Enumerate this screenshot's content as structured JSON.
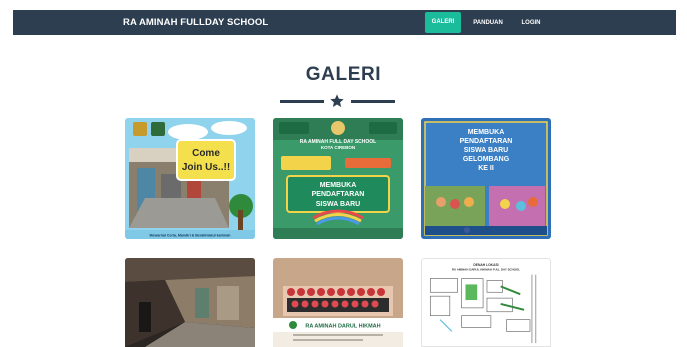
{
  "navbar": {
    "brand": "RA AMINAH FULLDAY SCHOOL",
    "items": [
      {
        "label": "GALERI",
        "active": true
      },
      {
        "label": "PANDUAN",
        "active": false
      },
      {
        "label": "LOGIN",
        "active": false
      }
    ],
    "background_color": "#2c3e50",
    "active_color": "#1abc9c"
  },
  "page": {
    "title": "GALERI",
    "divider_icon": "star-icon"
  },
  "gallery": {
    "items": [
      {
        "poster_line1": "Come",
        "poster_line2": "Join Us..!!",
        "caption": "Mewarnai Ceria, Mandiri & Berakhlakul karimah"
      },
      {
        "school_line1": "RA AMINAH FULL DAY SCHOOL",
        "school_line2": "KOTA CIREBON",
        "banner_line1": "MEMBUKA",
        "banner_line2": "PENDAFTARAN",
        "banner_line3": "SISWA BARU"
      },
      {
        "line1": "MEMBUKA",
        "line2": "PENDAFTARAN",
        "line3": "SISWA BARU",
        "line4": "GELOMBANG",
        "line5": "KE II"
      },
      {},
      {
        "banner_text": "RA AMINAH DARUL HIKMAH"
      },
      {
        "map_title_line1": "DENAH LOKASI",
        "map_title_line2": "RA AMINAH DARUL HIKMAH FULL DAY SCHOOL"
      }
    ]
  }
}
